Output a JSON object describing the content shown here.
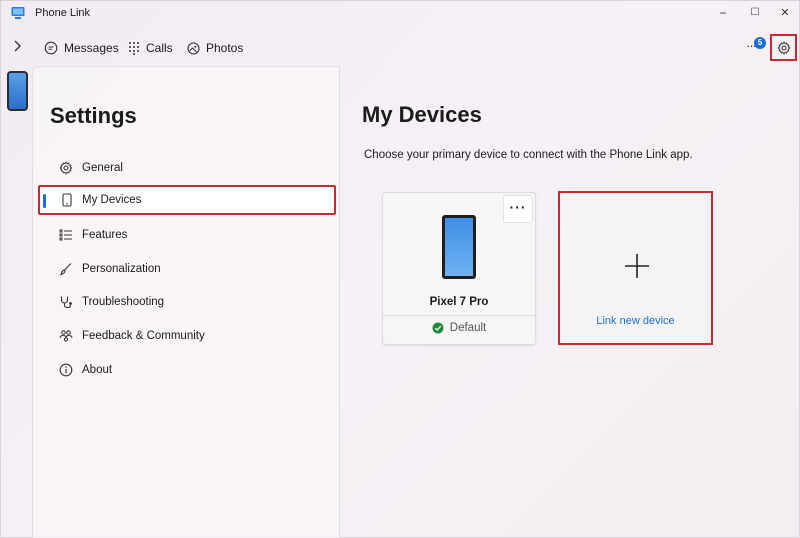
{
  "window": {
    "title": "Phone Link",
    "controls": {
      "minimize": "−",
      "maximize": "☐",
      "close": "✕"
    }
  },
  "nav": {
    "tabs": [
      {
        "label": "Messages",
        "icon": "chat-icon"
      },
      {
        "label": "Calls",
        "icon": "dialpad-icon"
      },
      {
        "label": "Photos",
        "icon": "photos-icon"
      }
    ],
    "notifications": {
      "dots": "···",
      "count": "5"
    }
  },
  "settings": {
    "heading": "Settings",
    "menu": [
      {
        "label": "General",
        "icon": "gear-icon"
      },
      {
        "label": "My Devices",
        "icon": "phone-icon",
        "active": true
      },
      {
        "label": "Features",
        "icon": "list-icon"
      },
      {
        "label": "Personalization",
        "icon": "brush-icon"
      },
      {
        "label": "Troubleshooting",
        "icon": "stethoscope-icon"
      },
      {
        "label": "Feedback & Community",
        "icon": "people-icon"
      },
      {
        "label": "About",
        "icon": "info-icon"
      }
    ]
  },
  "main": {
    "title": "My Devices",
    "description": "Choose your primary device to connect with the Phone Link app.",
    "device": {
      "name": "Pixel 7 Pro",
      "status": "Default",
      "more": "···"
    },
    "link_new": {
      "label": "Link new device"
    }
  },
  "colors": {
    "accent": "#1a6ed8",
    "highlight": "#c62a33",
    "success": "#1e8a3a"
  }
}
